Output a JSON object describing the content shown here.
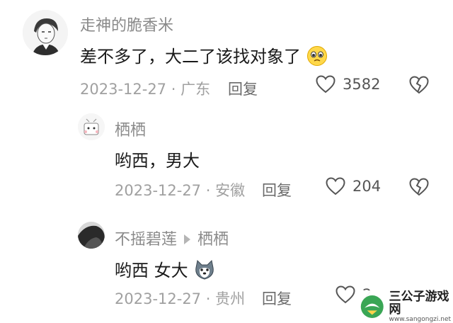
{
  "comments": [
    {
      "username": "走神的脆香米",
      "text": "差不多了，大二了该找对象了",
      "emoji_icon": "pleading-face-icon",
      "meta": "2023-12-27 · 广东",
      "reply_label": "回复",
      "likes": "3582"
    },
    {
      "username": "栖栖",
      "text": "哟西，男大",
      "meta": "2023-12-27 · 安徽",
      "reply_label": "回复",
      "likes": "204"
    },
    {
      "username": "不摇碧莲",
      "reply_to": "栖栖",
      "text": "哟西 女大",
      "emoji_icon": "husky-face-icon",
      "meta": "2023-12-27 · 贵州",
      "reply_label": "回复",
      "likes": "2"
    }
  ],
  "watermark": {
    "title": "三公子游戏网",
    "url": "www.sangongzi.net"
  },
  "colors": {
    "text": "#1a1a1a",
    "meta": "#a0a0a0",
    "username": "#8a8a8a",
    "icon": "#555555"
  }
}
